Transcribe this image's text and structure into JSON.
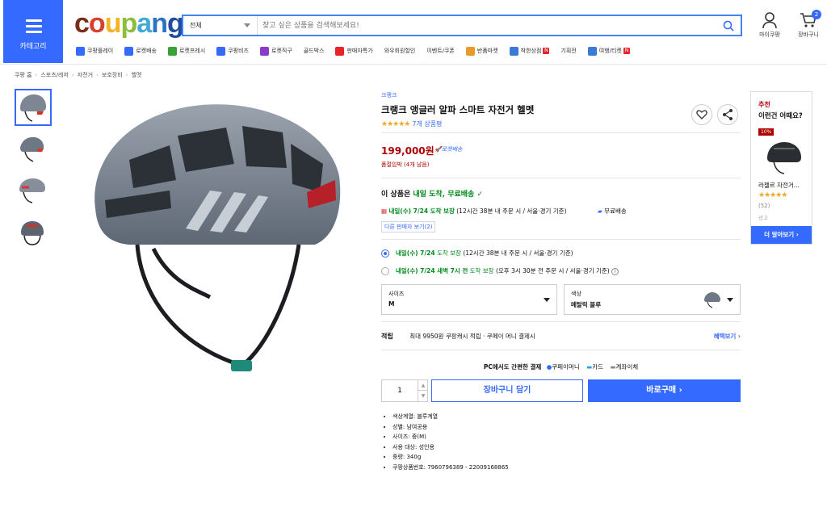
{
  "header": {
    "category_label": "카테고리",
    "logo": {
      "c1": "c",
      "o1": "o",
      "u": "u",
      "p": "p",
      "a": "a",
      "n": "n",
      "g": "g"
    },
    "search": {
      "scope": "전체",
      "placeholder": "찾고 싶은 상품을 검색해보세요!"
    },
    "user_label": "마이쿠팡",
    "cart_label": "장바구니",
    "cart_count": "2"
  },
  "nav": [
    {
      "label": "쿠팡플레이",
      "icon": "play-icon",
      "color": "#346aff"
    },
    {
      "label": "로켓배송",
      "icon": "rocket-icon",
      "color": "#346aff"
    },
    {
      "label": "로켓프레시",
      "icon": "rocket-fresh-icon",
      "color": "#3aa13a"
    },
    {
      "label": "쿠팡비즈",
      "icon": "biz-icon",
      "color": "#346aff"
    },
    {
      "label": "로켓직구",
      "icon": "globe-icon",
      "color": "#8a3cc9"
    },
    {
      "label": "골드박스",
      "icon": "",
      "color": ""
    },
    {
      "label": "판매자특가",
      "icon": "percent-icon",
      "color": "#e52528"
    },
    {
      "label": "와우회원할인",
      "icon": "",
      "color": ""
    },
    {
      "label": "이벤트/쿠폰",
      "icon": "",
      "color": ""
    },
    {
      "label": "반품마켓",
      "icon": "box-icon",
      "color": "#e89b2a"
    },
    {
      "label": "착한상점",
      "icon": "shop-icon",
      "color": "#3a7bd5",
      "new": "N"
    },
    {
      "label": "기획전",
      "icon": "",
      "color": ""
    },
    {
      "label": "여행/티켓",
      "icon": "plane-icon",
      "color": "#3a7bd5",
      "new": "N"
    }
  ],
  "breadcrumb": [
    "쿠팡 홈",
    "스포츠/레저",
    "자전거",
    "보호장비",
    "헬멧"
  ],
  "product": {
    "brand": "크랭크",
    "title": "크랭크 앵글러 알파 스마트 자전거 헬멧",
    "stars": "★★★★★",
    "review_count": "7개 상품평",
    "price": "199,000원",
    "rocket": "로켓배송",
    "stock": "품절임박 (4개 남음)",
    "delivery_head_prefix": "이 상품은 ",
    "delivery_head_green": "내일 도착, 무료배송",
    "delivery_head_check": "✓",
    "delivery_date": "내일(수) 7/24 도착 보장",
    "delivery_note": " (12시간 38분  내 주문 시 / 서울·경기 기준)",
    "free_shipping": "무료배송",
    "other_sellers": "다른 판매자 보기(2)",
    "option1_green": "내일(수) 7/24",
    "option1_small": " 도착 보장",
    "option1_note": " (12시간 38분 내 주문 시 / 서울·경기 기준)",
    "option2_green": "내일(수) 7/24 새벽 7시 전",
    "option2_small": " 도착 보장",
    "option2_note": " (오후 3시 30분 전 주문 시 / 서울·경기 기준)",
    "option2_info": "i",
    "size_label": "사이즈",
    "size_value": "M",
    "color_label": "색상",
    "color_value": "메탈릭 블루",
    "reward_label": "적립",
    "reward_text": "최대 9950원 쿠팡캐시 적립 · 쿠페이 머니 결제시",
    "reward_link": "혜택보기 ›",
    "pc_pay": "PC에서도 간편한 결제",
    "pay_methods": [
      "쿠페이머니",
      "카드",
      "계좌이체"
    ],
    "quantity": "1",
    "add_cart": "장바구니 담기",
    "buy_now": "바로구매 ›",
    "attributes": [
      "색상계열: 블루계열",
      "성별: 남여공용",
      "사이즈: 중(M)",
      "사용 대상: 성인용",
      "중량: 340g",
      "쿠팡상품번호: 7960796389 - 22009168865"
    ]
  },
  "side": {
    "tag": "추천",
    "title": "이런건 어때요?",
    "discount": "10%",
    "product_name": "라젤르 자전거...",
    "stars": "★★★★★",
    "count": "(52)",
    "ad": "광고",
    "more": "더 알아보기 ›"
  },
  "colors": {
    "accent": "#346aff",
    "price": "#ae0000",
    "green": "#00891a"
  }
}
